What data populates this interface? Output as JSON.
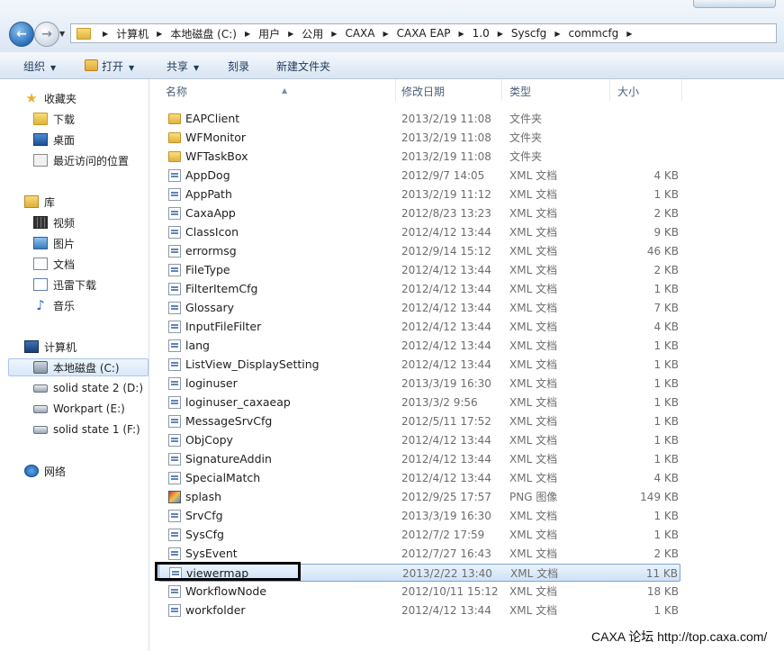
{
  "breadcrumb": [
    "计算机",
    "本地磁盘 (C:)",
    "用户",
    "公用",
    "CAXA",
    "CAXA EAP",
    "1.0",
    "Syscfg",
    "commcfg"
  ],
  "toolbar": {
    "organize": "组织",
    "open": "打开",
    "share": "共享",
    "burn": "刻录",
    "new_folder": "新建文件夹"
  },
  "nav": {
    "favorites": "收藏夹",
    "downloads": "下载",
    "desktop": "桌面",
    "recent": "最近访问的位置",
    "libraries": "库",
    "videos": "视频",
    "pictures": "图片",
    "documents": "文档",
    "thunder": "迅雷下载",
    "music": "音乐",
    "computer": "计算机",
    "drive_c": "本地磁盘 (C:)",
    "drive_d": "solid state 2 (D:)",
    "drive_e": "Workpart (E:)",
    "drive_f": "solid state 1 (F:)",
    "network": "网络"
  },
  "columns": {
    "name": "名称",
    "date": "修改日期",
    "type": "类型",
    "size": "大小"
  },
  "files": [
    {
      "name": "EAPClient",
      "date": "2013/2/19 11:08",
      "type": "文件夹",
      "size": "",
      "icon": "folder-icon"
    },
    {
      "name": "WFMonitor",
      "date": "2013/2/19 11:08",
      "type": "文件夹",
      "size": "",
      "icon": "folder-icon"
    },
    {
      "name": "WFTaskBox",
      "date": "2013/2/19 11:08",
      "type": "文件夹",
      "size": "",
      "icon": "folder-icon"
    },
    {
      "name": "AppDog",
      "date": "2012/9/7 14:05",
      "type": "XML 文档",
      "size": "4 KB",
      "icon": "xml-file-icon"
    },
    {
      "name": "AppPath",
      "date": "2013/2/19 11:12",
      "type": "XML 文档",
      "size": "1 KB",
      "icon": "xml-file-icon"
    },
    {
      "name": "CaxaApp",
      "date": "2012/8/23 13:23",
      "type": "XML 文档",
      "size": "2 KB",
      "icon": "xml-file-icon"
    },
    {
      "name": "ClassIcon",
      "date": "2012/4/12 13:44",
      "type": "XML 文档",
      "size": "9 KB",
      "icon": "xml-file-icon"
    },
    {
      "name": "errormsg",
      "date": "2012/9/14 15:12",
      "type": "XML 文档",
      "size": "46 KB",
      "icon": "xml-file-icon"
    },
    {
      "name": "FileType",
      "date": "2012/4/12 13:44",
      "type": "XML 文档",
      "size": "2 KB",
      "icon": "xml-file-icon"
    },
    {
      "name": "FilterItemCfg",
      "date": "2012/4/12 13:44",
      "type": "XML 文档",
      "size": "1 KB",
      "icon": "xml-file-icon"
    },
    {
      "name": "Glossary",
      "date": "2012/4/12 13:44",
      "type": "XML 文档",
      "size": "7 KB",
      "icon": "xml-file-icon"
    },
    {
      "name": "InputFileFilter",
      "date": "2012/4/12 13:44",
      "type": "XML 文档",
      "size": "4 KB",
      "icon": "xml-file-icon"
    },
    {
      "name": "lang",
      "date": "2012/4/12 13:44",
      "type": "XML 文档",
      "size": "1 KB",
      "icon": "xml-file-icon"
    },
    {
      "name": "ListView_DisplaySetting",
      "date": "2012/4/12 13:44",
      "type": "XML 文档",
      "size": "1 KB",
      "icon": "xml-file-icon"
    },
    {
      "name": "loginuser",
      "date": "2013/3/19 16:30",
      "type": "XML 文档",
      "size": "1 KB",
      "icon": "xml-file-icon"
    },
    {
      "name": "loginuser_caxaeap",
      "date": "2013/3/2 9:56",
      "type": "XML 文档",
      "size": "1 KB",
      "icon": "xml-file-icon"
    },
    {
      "name": "MessageSrvCfg",
      "date": "2012/5/11 17:52",
      "type": "XML 文档",
      "size": "1 KB",
      "icon": "xml-file-icon"
    },
    {
      "name": "ObjCopy",
      "date": "2012/4/12 13:44",
      "type": "XML 文档",
      "size": "1 KB",
      "icon": "xml-file-icon"
    },
    {
      "name": "SignatureAddin",
      "date": "2012/4/12 13:44",
      "type": "XML 文档",
      "size": "1 KB",
      "icon": "xml-file-icon"
    },
    {
      "name": "SpecialMatch",
      "date": "2012/4/12 13:44",
      "type": "XML 文档",
      "size": "4 KB",
      "icon": "xml-file-icon"
    },
    {
      "name": "splash",
      "date": "2012/9/25 17:57",
      "type": "PNG 图像",
      "size": "149 KB",
      "icon": "png-file-icon"
    },
    {
      "name": "SrvCfg",
      "date": "2013/3/19 16:30",
      "type": "XML 文档",
      "size": "1 KB",
      "icon": "xml-file-icon"
    },
    {
      "name": "SysCfg",
      "date": "2012/7/2 17:59",
      "type": "XML 文档",
      "size": "1 KB",
      "icon": "xml-file-icon"
    },
    {
      "name": "SysEvent",
      "date": "2012/7/27 16:43",
      "type": "XML 文档",
      "size": "2 KB",
      "icon": "xml-file-icon"
    },
    {
      "name": "viewermap",
      "date": "2013/2/22 13:40",
      "type": "XML 文档",
      "size": "11 KB",
      "icon": "xml-file-icon",
      "selected": true
    },
    {
      "name": "WorkflowNode",
      "date": "2012/10/11 15:12",
      "type": "XML 文档",
      "size": "18 KB",
      "icon": "xml-file-icon"
    },
    {
      "name": "workfolder",
      "date": "2012/4/12 13:44",
      "type": "XML 文档",
      "size": "1 KB",
      "icon": "xml-file-icon"
    }
  ],
  "watermark": "CAXA 论坛 http://top.caxa.com/"
}
